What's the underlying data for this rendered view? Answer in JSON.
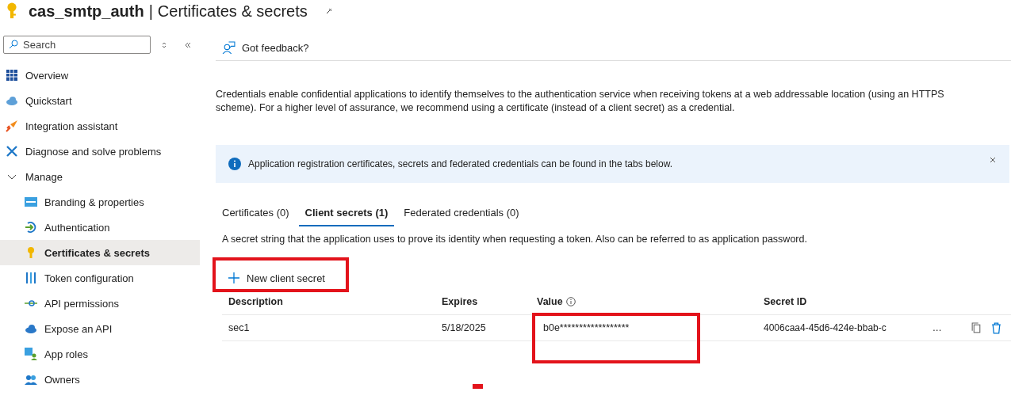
{
  "header": {
    "title": "cas_smtp_auth",
    "separator": "|",
    "subtitle": "Certificates & secrets"
  },
  "sidebar": {
    "search": {
      "placeholder": "Search"
    },
    "items": [
      {
        "label": "Overview",
        "selected": false
      },
      {
        "label": "Quickstart",
        "selected": false
      },
      {
        "label": "Integration assistant",
        "selected": false
      },
      {
        "label": "Diagnose and solve problems",
        "selected": false
      },
      {
        "label": "Manage",
        "expanded": true,
        "selected": false,
        "children": [
          {
            "label": "Branding & properties",
            "selected": false
          },
          {
            "label": "Authentication",
            "selected": false
          },
          {
            "label": "Certificates & secrets",
            "selected": true
          },
          {
            "label": "Token configuration",
            "selected": false
          },
          {
            "label": "API permissions",
            "selected": false
          },
          {
            "label": "Expose an API",
            "selected": false
          },
          {
            "label": "App roles",
            "selected": false
          },
          {
            "label": "Owners",
            "selected": false
          }
        ]
      }
    ]
  },
  "toolbar": {
    "feedback": "Got feedback?"
  },
  "description": "Credentials enable confidential applications to identify themselves to the authentication service when receiving tokens at a web addressable location (using an HTTPS scheme). For a higher level of assurance, we recommend using a certificate (instead of a client secret) as a credential.",
  "info_banner": {
    "text": "Application registration certificates, secrets and federated credentials can be found in the tabs below."
  },
  "tabs": [
    {
      "label": "Certificates (0)",
      "selected": false
    },
    {
      "label": "Client secrets (1)",
      "selected": true
    },
    {
      "label": "Federated credentials (0)",
      "selected": false
    }
  ],
  "tab_description": "A secret string that the application uses to prove its identity when requesting a token. Also can be referred to as application password.",
  "new_button": "New client secret",
  "table": {
    "columns": [
      "Description",
      "Expires",
      "Value",
      "Secret ID"
    ],
    "rows": [
      {
        "description": "sec1",
        "expires": "5/18/2025",
        "value": "b0e******************",
        "secret_id": "4006caa4-45d6-424e-bbab-c",
        "secret_id_end": "…"
      }
    ]
  }
}
